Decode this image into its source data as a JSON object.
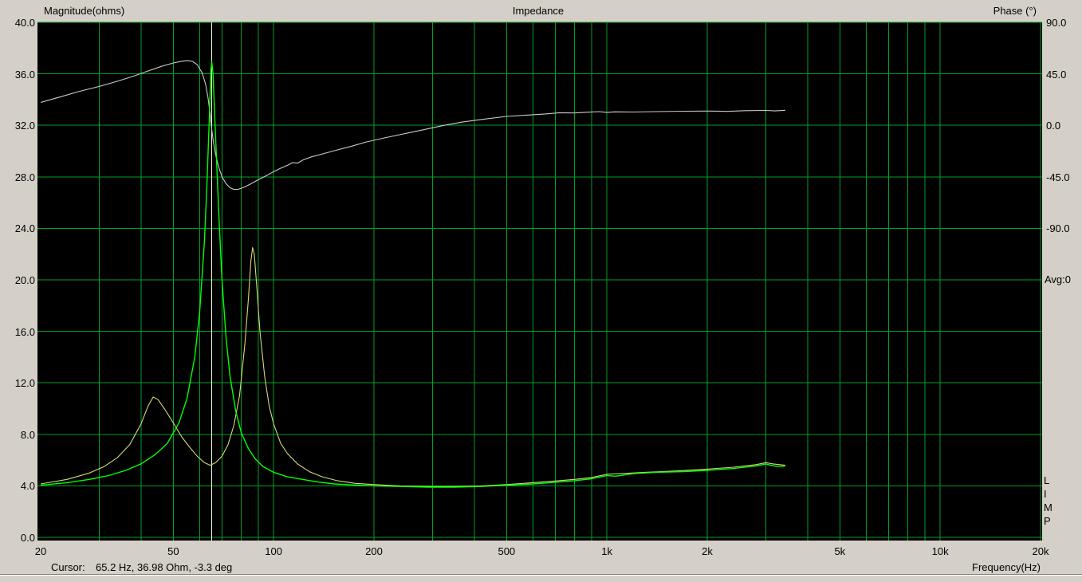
{
  "header": {
    "magnitude_axis_title": "Magnitude(ohms)",
    "chart_title": "Impedance",
    "phase_axis_title": "Phase (°)"
  },
  "status": {
    "cursor_label": "Cursor:",
    "cursor_value": "65.2 Hz, 36.98 Ohm, -3.3 deg",
    "x_axis_label": "Frequency(Hz)",
    "avg_label": "Avg:0",
    "limp_letters": [
      "L",
      "I",
      "M",
      "P"
    ]
  },
  "colors": {
    "window_bg": "#d4d0c8",
    "plot_bg": "#000000",
    "grid": "#00a028",
    "magnitude_curve": "#00ff00",
    "overlay_curve": "#d8d87c",
    "phase_curve": "#cbcbcb",
    "cursor_line": "#fafac8",
    "text": "#000000"
  },
  "chart_data": {
    "type": "line",
    "title": "Impedance",
    "xlabel": "Frequency(Hz)",
    "x_scale": "log",
    "x_range_hz": [
      20,
      20000
    ],
    "x_major_ticks": [
      {
        "f": 20,
        "label": "20"
      },
      {
        "f": 50,
        "label": "50"
      },
      {
        "f": 100,
        "label": "100"
      },
      {
        "f": 200,
        "label": "200"
      },
      {
        "f": 500,
        "label": "500"
      },
      {
        "f": 1000,
        "label": "1k"
      },
      {
        "f": 2000,
        "label": "2k"
      },
      {
        "f": 5000,
        "label": "5k"
      },
      {
        "f": 10000,
        "label": "10k"
      },
      {
        "f": 20000,
        "label": "20k"
      }
    ],
    "x_grid_hz": [
      30,
      40,
      50,
      60,
      70,
      80,
      90,
      100,
      200,
      300,
      400,
      500,
      600,
      700,
      800,
      900,
      1000,
      2000,
      3000,
      4000,
      5000,
      6000,
      7000,
      8000,
      9000,
      10000,
      20000
    ],
    "y_left": {
      "label": "Magnitude(ohms)",
      "min": 0,
      "max": 40,
      "step": 4,
      "tick_labels": [
        "40.0",
        "36.0",
        "32.0",
        "28.0",
        "24.0",
        "20.0",
        "16.0",
        "12.0",
        "8.0",
        "4.0",
        "0.0"
      ],
      "tick_values": [
        40,
        36,
        32,
        28,
        24,
        20,
        16,
        12,
        8,
        4,
        0
      ]
    },
    "y_right": {
      "label": "Phase (°)",
      "deg_per_division": 45,
      "tick_labels": [
        "90.0",
        "45.0",
        "0.0",
        "-45.0",
        "-90.0"
      ],
      "tick_values": [
        90,
        45,
        0,
        -45,
        -90
      ]
    },
    "cursor": {
      "freq_hz": 65.2,
      "ohm": 36.98,
      "deg": -3.3
    },
    "legend_position": "none",
    "grid_on": true,
    "series": [
      {
        "name": "impedance-magnitude",
        "unit": "ohm",
        "color": "#00ff00",
        "points": [
          [
            20,
            4.05
          ],
          [
            24,
            4.25
          ],
          [
            28,
            4.5
          ],
          [
            32,
            4.8
          ],
          [
            36,
            5.2
          ],
          [
            40,
            5.7
          ],
          [
            44,
            6.4
          ],
          [
            48,
            7.3
          ],
          [
            52,
            8.9
          ],
          [
            55,
            10.8
          ],
          [
            58,
            14
          ],
          [
            60,
            17.5
          ],
          [
            62,
            23
          ],
          [
            63,
            27
          ],
          [
            64,
            32
          ],
          [
            64.8,
            36.2
          ],
          [
            65.2,
            36.98
          ],
          [
            65.8,
            36
          ],
          [
            66.5,
            33
          ],
          [
            67.5,
            29
          ],
          [
            68.5,
            25
          ],
          [
            70,
            20
          ],
          [
            72,
            15.5
          ],
          [
            74,
            12.5
          ],
          [
            77,
            9.8
          ],
          [
            80,
            8.1
          ],
          [
            84,
            6.9
          ],
          [
            88,
            6.1
          ],
          [
            93,
            5.5
          ],
          [
            100,
            5.05
          ],
          [
            110,
            4.7
          ],
          [
            122,
            4.5
          ],
          [
            136,
            4.3
          ],
          [
            152,
            4.15
          ],
          [
            170,
            4.08
          ],
          [
            200,
            4.0
          ],
          [
            240,
            3.95
          ],
          [
            290,
            3.9
          ],
          [
            350,
            3.9
          ],
          [
            420,
            3.95
          ],
          [
            500,
            4.05
          ],
          [
            600,
            4.15
          ],
          [
            700,
            4.28
          ],
          [
            800,
            4.4
          ],
          [
            900,
            4.55
          ],
          [
            960,
            4.7
          ],
          [
            1000,
            4.8
          ],
          [
            1060,
            4.75
          ],
          [
            1200,
            4.95
          ],
          [
            1400,
            5.05
          ],
          [
            1700,
            5.1
          ],
          [
            2000,
            5.2
          ],
          [
            2400,
            5.35
          ],
          [
            2800,
            5.55
          ],
          [
            3000,
            5.7
          ],
          [
            3100,
            5.6
          ],
          [
            3250,
            5.5
          ],
          [
            3430,
            5.55
          ]
        ]
      },
      {
        "name": "impedance-magnitude-overlay",
        "unit": "ohm",
        "color": "#d8d87c",
        "points": [
          [
            20,
            4.15
          ],
          [
            24,
            4.5
          ],
          [
            28,
            5.0
          ],
          [
            31,
            5.5
          ],
          [
            34,
            6.2
          ],
          [
            37,
            7.2
          ],
          [
            40,
            8.8
          ],
          [
            42,
            10.2
          ],
          [
            43.5,
            10.9
          ],
          [
            45,
            10.7
          ],
          [
            47,
            10.0
          ],
          [
            50,
            8.9
          ],
          [
            53,
            7.8
          ],
          [
            56,
            7.0
          ],
          [
            59,
            6.3
          ],
          [
            62,
            5.8
          ],
          [
            64.5,
            5.6
          ],
          [
            67,
            5.8
          ],
          [
            70,
            6.3
          ],
          [
            73,
            7.2
          ],
          [
            76,
            8.7
          ],
          [
            79,
            11
          ],
          [
            82,
            15
          ],
          [
            84,
            18.5
          ],
          [
            85.5,
            21.5
          ],
          [
            86.5,
            22.5
          ],
          [
            87.5,
            22
          ],
          [
            89,
            19.5
          ],
          [
            91,
            16
          ],
          [
            94,
            12.5
          ],
          [
            97,
            10.2
          ],
          [
            100,
            8.8
          ],
          [
            105,
            7.3
          ],
          [
            110,
            6.5
          ],
          [
            118,
            5.7
          ],
          [
            128,
            5.1
          ],
          [
            140,
            4.7
          ],
          [
            155,
            4.4
          ],
          [
            175,
            4.2
          ],
          [
            200,
            4.1
          ],
          [
            240,
            4.0
          ],
          [
            290,
            3.95
          ],
          [
            350,
            3.95
          ],
          [
            420,
            4.0
          ],
          [
            500,
            4.1
          ],
          [
            600,
            4.25
          ],
          [
            700,
            4.38
          ],
          [
            800,
            4.5
          ],
          [
            900,
            4.65
          ],
          [
            1000,
            4.9
          ],
          [
            1100,
            4.95
          ],
          [
            1300,
            5.05
          ],
          [
            1600,
            5.15
          ],
          [
            2000,
            5.3
          ],
          [
            2400,
            5.45
          ],
          [
            2800,
            5.65
          ],
          [
            3000,
            5.8
          ],
          [
            3150,
            5.7
          ],
          [
            3430,
            5.6
          ]
        ]
      },
      {
        "name": "impedance-phase",
        "unit": "deg",
        "color": "#cbcbcb",
        "points": [
          [
            20,
            20
          ],
          [
            23,
            25
          ],
          [
            26,
            29.5
          ],
          [
            30,
            34
          ],
          [
            34,
            38.5
          ],
          [
            38,
            43
          ],
          [
            42,
            47.5
          ],
          [
            46,
            51.5
          ],
          [
            50,
            54.5
          ],
          [
            53,
            56
          ],
          [
            55,
            56.5
          ],
          [
            57,
            56
          ],
          [
            59,
            53
          ],
          [
            61,
            46
          ],
          [
            62.5,
            36
          ],
          [
            63.5,
            25
          ],
          [
            64.5,
            10
          ],
          [
            65.2,
            -3.3
          ],
          [
            66,
            -15
          ],
          [
            67,
            -26
          ],
          [
            68.5,
            -37
          ],
          [
            70,
            -45
          ],
          [
            72,
            -51
          ],
          [
            74,
            -54.5
          ],
          [
            76,
            -56
          ],
          [
            78,
            -56
          ],
          [
            81,
            -54.5
          ],
          [
            85,
            -51.5
          ],
          [
            90,
            -47.5
          ],
          [
            95,
            -44
          ],
          [
            100,
            -40.5
          ],
          [
            105,
            -37.5
          ],
          [
            110,
            -35
          ],
          [
            114,
            -32.5
          ],
          [
            118,
            -33
          ],
          [
            123,
            -30
          ],
          [
            130,
            -27.5
          ],
          [
            140,
            -25
          ],
          [
            155,
            -21.5
          ],
          [
            170,
            -18.5
          ],
          [
            190,
            -14.5
          ],
          [
            215,
            -11
          ],
          [
            245,
            -7.5
          ],
          [
            280,
            -4
          ],
          [
            325,
            0
          ],
          [
            370,
            3
          ],
          [
            430,
            5.5
          ],
          [
            500,
            7.8
          ],
          [
            580,
            9
          ],
          [
            660,
            10
          ],
          [
            720,
            11
          ],
          [
            800,
            10.8
          ],
          [
            880,
            11.5
          ],
          [
            950,
            12
          ],
          [
            1000,
            11.2
          ],
          [
            1050,
            11.8
          ],
          [
            1200,
            11.6
          ],
          [
            1400,
            12
          ],
          [
            1700,
            12.3
          ],
          [
            2000,
            12.5
          ],
          [
            2300,
            12.2
          ],
          [
            2600,
            12.8
          ],
          [
            3000,
            13
          ],
          [
            3200,
            12.6
          ],
          [
            3430,
            13.2
          ]
        ]
      }
    ]
  }
}
